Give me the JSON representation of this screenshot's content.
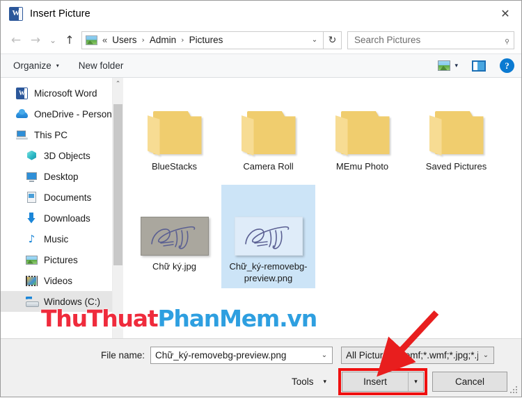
{
  "window": {
    "title": "Insert Picture",
    "app_icon": "word-icon",
    "close_label": "✕"
  },
  "nav": {
    "back": "←",
    "forward": "→",
    "recent": "⌄",
    "up": "↑",
    "path_icon": "pictures-folder-icon",
    "path_prefix": "«",
    "breadcrumbs": [
      "Users",
      "Admin",
      "Pictures"
    ],
    "crumb_sep": "›",
    "dropdown": "⌄",
    "refresh": "↻"
  },
  "search": {
    "placeholder": "Search Pictures",
    "icon": "⌕"
  },
  "toolbar": {
    "organize_label": "Organize",
    "organize_caret": "▾",
    "new_folder_label": "New folder",
    "view_caret": "▾",
    "help_label": "?"
  },
  "sidebar": {
    "scroll_up": "⌃",
    "items": [
      {
        "label": "Microsoft Word",
        "icon": "word-icon",
        "indent": false,
        "selected": false
      },
      {
        "label": "OneDrive - Person",
        "icon": "onedrive-icon",
        "indent": false,
        "selected": false
      },
      {
        "label": "This PC",
        "icon": "this-pc-icon",
        "indent": false,
        "selected": false
      },
      {
        "label": "3D Objects",
        "icon": "3d-objects-icon",
        "indent": true,
        "selected": false
      },
      {
        "label": "Desktop",
        "icon": "desktop-icon",
        "indent": true,
        "selected": false
      },
      {
        "label": "Documents",
        "icon": "documents-icon",
        "indent": true,
        "selected": false
      },
      {
        "label": "Downloads",
        "icon": "downloads-icon",
        "indent": true,
        "selected": false
      },
      {
        "label": "Music",
        "icon": "music-icon",
        "indent": true,
        "selected": false
      },
      {
        "label": "Pictures",
        "icon": "pictures-icon",
        "indent": true,
        "selected": false
      },
      {
        "label": "Videos",
        "icon": "videos-icon",
        "indent": true,
        "selected": false
      },
      {
        "label": "Windows (C:)",
        "icon": "windows-drive-icon",
        "indent": true,
        "selected": true
      }
    ]
  },
  "files": {
    "row1": [
      {
        "name": "BlueStacks",
        "type": "folder",
        "selected": false
      },
      {
        "name": "Camera Roll",
        "type": "folder",
        "selected": false
      },
      {
        "name": "MEmu Photo",
        "type": "folder",
        "selected": false
      },
      {
        "name": "Saved Pictures",
        "type": "folder",
        "selected": false
      }
    ],
    "row2": [
      {
        "name": "Chữ ký.jpg",
        "type": "photo",
        "selected": false
      },
      {
        "name": "Chữ_ký-removebg-preview.png",
        "type": "transparent",
        "selected": true
      }
    ]
  },
  "watermark": {
    "part1": "ThuThuat",
    "part2": "PhanMem.vn",
    "color1": "#ef2b3c",
    "color2": "#2e9fe0"
  },
  "footer": {
    "filename_label": "File name:",
    "filename_value": "Chữ_ký-removebg-preview.png",
    "filename_caret": "⌄",
    "filetype_value": "All Pictures (*.emf;*.wmf;*.jpg;*.j",
    "filetype_caret": "⌄",
    "tools_label": "Tools",
    "tools_caret": "▾",
    "insert_label": "Insert",
    "insert_caret": "▾",
    "cancel_label": "Cancel"
  },
  "annotation": {
    "highlight_color": "#ef1010",
    "arrow_color": "#e81e1e",
    "target": "insert-button"
  }
}
